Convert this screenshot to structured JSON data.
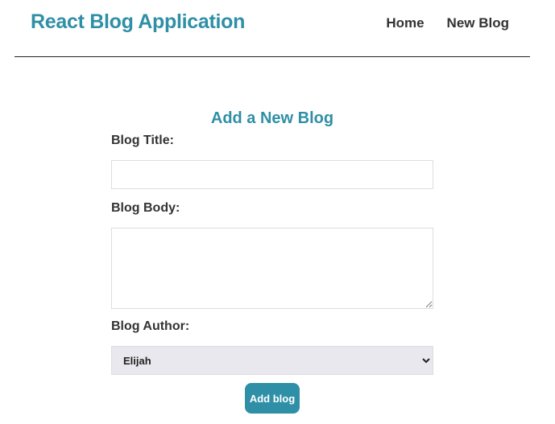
{
  "navbar": {
    "title": "React Blog Application",
    "links": [
      {
        "label": "Home"
      },
      {
        "label": "New Blog"
      }
    ]
  },
  "form": {
    "heading": "Add a New Blog",
    "title_label": "Blog Title:",
    "title_value": "",
    "body_label": "Blog Body:",
    "body_value": "",
    "author_label": "Blog Author:",
    "author_selected": "Elijah",
    "submit_label": "Add blog"
  },
  "colors": {
    "accent": "#2f8fa6",
    "text": "#333333",
    "select_bg": "#e8e8ee"
  }
}
